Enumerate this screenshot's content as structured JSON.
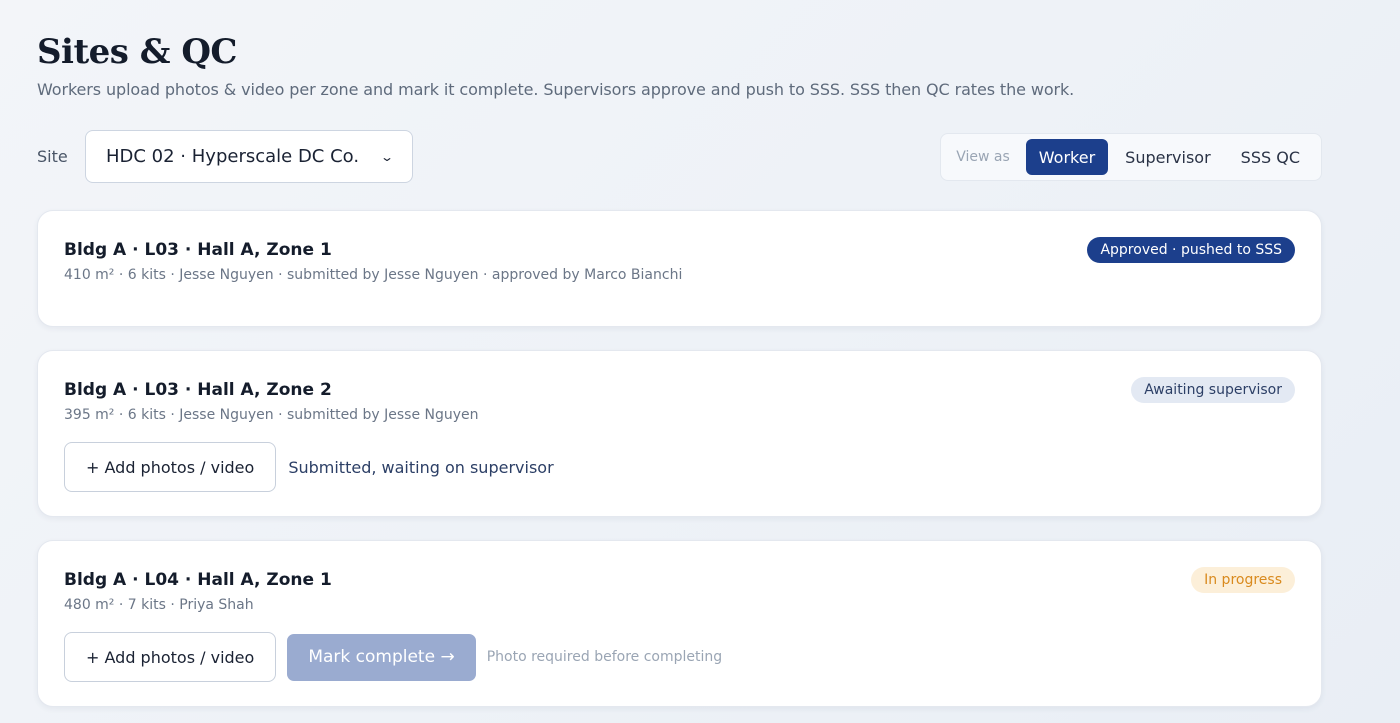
{
  "header": {
    "title": "Sites & QC",
    "subtitle": "Workers upload photos & video per zone and mark it complete. Supervisors approve and push to SSS. SSS then QC rates the work."
  },
  "site": {
    "label": "Site",
    "selected": "HDC 02 · Hyperscale DC Co."
  },
  "view_as": {
    "label": "View as",
    "options": [
      "Worker",
      "Supervisor",
      "SSS QC"
    ],
    "active": "Worker"
  },
  "zones": [
    {
      "title": "Bldg A · L03 · Hall A, Zone 1",
      "meta": "410 m² · 6 kits · Jesse Nguyen · submitted by Jesse Nguyen · approved by Marco Bianchi",
      "status": "Approved · pushed to SSS"
    },
    {
      "title": "Bldg A · L03 · Hall A, Zone 2",
      "meta": "395 m² · 6 kits · Jesse Nguyen · submitted by Jesse Nguyen",
      "status": "Awaiting supervisor",
      "add_media": "+ Add photos / video",
      "note": "Submitted, waiting on supervisor"
    },
    {
      "title": "Bldg A · L04 · Hall A, Zone 1",
      "meta": "480 m² · 7 kits · Priya Shah",
      "status": "In progress",
      "add_media": "+ Add photos / video",
      "mark_complete": "Mark complete →",
      "hint": "Photo required before completing"
    }
  ],
  "colors": {
    "accent": "#1c3f8c",
    "badge_awaiting_bg": "#e3e9f3",
    "badge_progress_bg": "#fcefd9",
    "badge_progress_text": "#d98a1e",
    "disabled_button": "#9aabd0"
  },
  "icons": {
    "select_chevron": "chevron-down-icon"
  }
}
